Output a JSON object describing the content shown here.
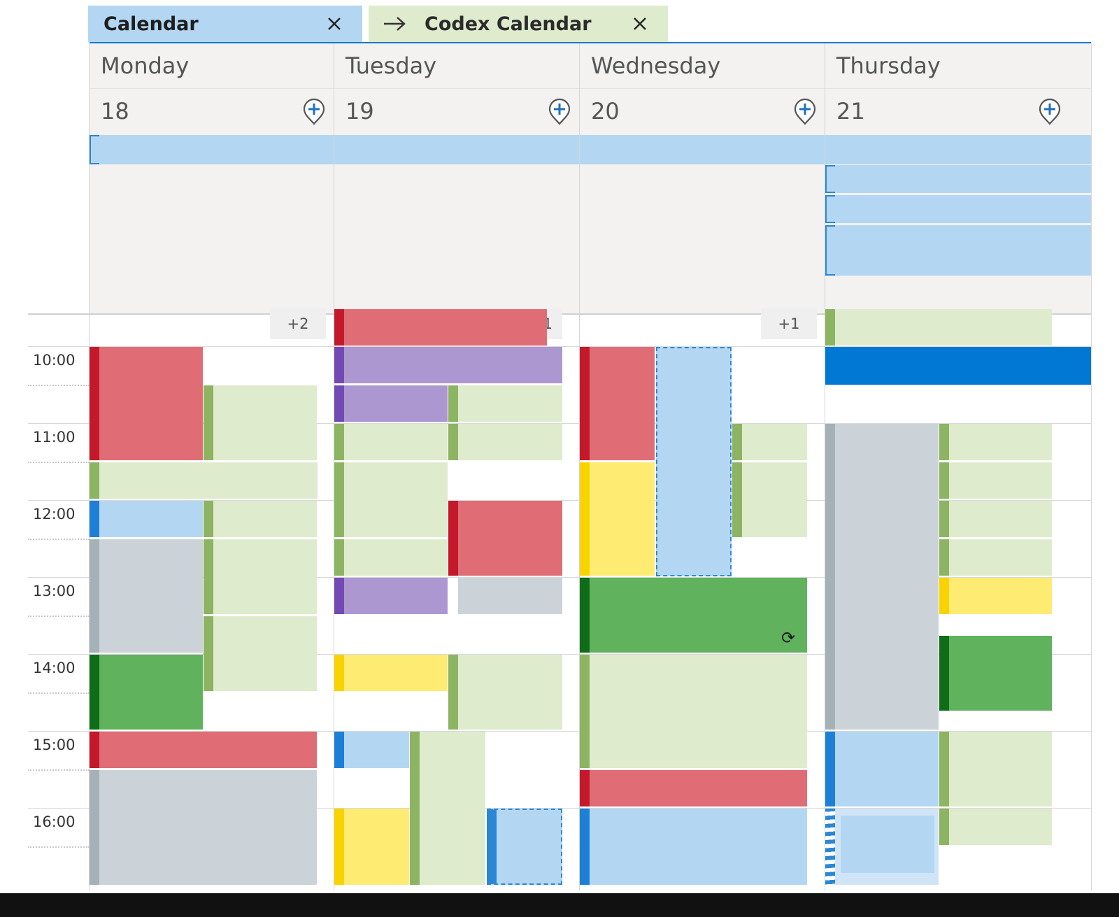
{
  "tabs": [
    {
      "label": "Calendar",
      "close_icon": "close-icon",
      "bg": "#b3d7f2"
    },
    {
      "label": "Codex Calendar",
      "arrow_icon": "arrow-right-icon",
      "close_icon": "close-icon",
      "bg": "#dfebcd"
    }
  ],
  "days": [
    {
      "name": "Monday",
      "number": "18"
    },
    {
      "name": "Tuesday",
      "number": "19"
    },
    {
      "name": "Wednesday",
      "number": "20"
    },
    {
      "name": "Thursday",
      "number": "21"
    }
  ],
  "more_buttons": [
    "+2",
    "1",
    "+1"
  ],
  "times": [
    "10:00",
    "11:00",
    "12:00",
    "13:00",
    "14:00",
    "15:00",
    "16:00"
  ],
  "colors": {
    "accent": "#0078d4",
    "red_event": "#e06c75",
    "green_event": "#dfebcd",
    "blue_event": "#b3d7f2",
    "gray_event": "#cbd3d8",
    "dark_green_event": "#60b35c",
    "yellow_event": "#fdeb72",
    "purple_event": "#ad97d1"
  },
  "icons": {
    "add_event": "map-pin-plus-icon",
    "recurring": "recurring-exception-icon"
  }
}
